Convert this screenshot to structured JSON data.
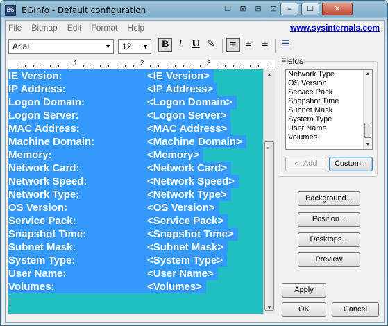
{
  "window": {
    "title": "BGInfo - Default configuration",
    "app_icon_text": "BG"
  },
  "title_bar": {
    "system_icons": [
      "☐",
      "⊠",
      "⊟",
      "⊡"
    ],
    "min_glyph": "–",
    "max_glyph": "☐",
    "close_glyph": "✕"
  },
  "menu": {
    "items": [
      "File",
      "Bitmap",
      "Edit",
      "Format",
      "Help"
    ],
    "link": "www.sysinternals.com"
  },
  "toolbar": {
    "font_name": "Arial",
    "font_size": "12",
    "dropdown_glyph": "▼",
    "bold": "B",
    "italic": "I",
    "underline": "U",
    "color_glyph": "✎",
    "align_left": "≡",
    "align_center": "≡",
    "align_right": "≡",
    "bullets": "☰"
  },
  "ruler": {
    "numbers": [
      "1",
      "2",
      "3"
    ]
  },
  "editor": {
    "rows": [
      {
        "label": "IE Version:",
        "value": "<IE Version>"
      },
      {
        "label": "IP Address:",
        "value": "<IP Address>"
      },
      {
        "label": "Logon Domain:",
        "value": "<Logon Domain>"
      },
      {
        "label": "Logon Server:",
        "value": "<Logon Server>"
      },
      {
        "label": "MAC Address:",
        "value": "<MAC Address>"
      },
      {
        "label": "Machine Domain:",
        "value": "<Machine Domain>"
      },
      {
        "label": "Memory:",
        "value": "<Memory>"
      },
      {
        "label": "Network Card:",
        "value": "<Network Card>"
      },
      {
        "label": "Network Speed:",
        "value": "<Network Speed>"
      },
      {
        "label": "Network Type:",
        "value": "<Network Type>"
      },
      {
        "label": "OS Version:",
        "value": "<OS Version>"
      },
      {
        "label": "Service Pack:",
        "value": "<Service Pack>"
      },
      {
        "label": "Snapshot Time:",
        "value": "<Snapshot Time>"
      },
      {
        "label": "Subnet Mask:",
        "value": "<Subnet Mask>"
      },
      {
        "label": "System Type:",
        "value": "<System Type>"
      },
      {
        "label": "User Name:",
        "value": "<User Name>"
      },
      {
        "label": "Volumes:",
        "value": "<Volumes>"
      }
    ],
    "background_color": "#20c0c0",
    "selection_color": "#3399ff"
  },
  "fields": {
    "label": "Fields",
    "items": [
      "Network Type",
      "OS Version",
      "Service Pack",
      "Snapshot Time",
      "Subnet Mask",
      "System Type",
      "User Name",
      "Volumes"
    ],
    "add_button": "<- Add",
    "custom_button": "Custom..."
  },
  "buttons": {
    "background": "Background...",
    "position": "Position...",
    "desktops": "Desktops...",
    "preview": "Preview",
    "apply": "Apply",
    "ok": "OK",
    "cancel": "Cancel"
  },
  "scroll": {
    "up": "▲",
    "down": "▼",
    "grip": "≡"
  }
}
